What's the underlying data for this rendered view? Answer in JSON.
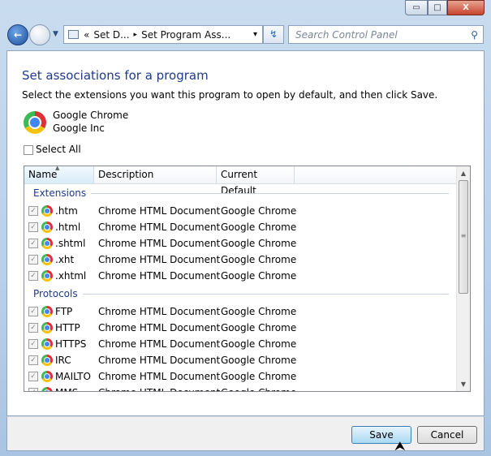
{
  "window": {
    "minimize": "▭",
    "maximize": "□",
    "close": "X"
  },
  "nav": {
    "breadcrumb_prefix": "«",
    "crumb1": "Set D...",
    "sep": "▸",
    "crumb2": "Set Program Ass...",
    "dropdown": "▾",
    "refresh": "↯",
    "search_placeholder": "Search Control Panel"
  },
  "page": {
    "title": "Set associations for a program",
    "instructions": "Select the extensions you want this program to open by default, and then click Save.",
    "program_name": "Google Chrome",
    "program_vendor": "Google Inc",
    "select_all": "Select All"
  },
  "list": {
    "columns": [
      "Name",
      "Description",
      "Current Default"
    ],
    "groups": [
      {
        "label": "Extensions",
        "items": [
          {
            "name": ".htm",
            "description": "Chrome HTML Document",
            "default": "Google Chrome",
            "checked": true
          },
          {
            "name": ".html",
            "description": "Chrome HTML Document",
            "default": "Google Chrome",
            "checked": true
          },
          {
            "name": ".shtml",
            "description": "Chrome HTML Document",
            "default": "Google Chrome",
            "checked": true
          },
          {
            "name": ".xht",
            "description": "Chrome HTML Document",
            "default": "Google Chrome",
            "checked": true
          },
          {
            "name": ".xhtml",
            "description": "Chrome HTML Document",
            "default": "Google Chrome",
            "checked": true
          }
        ]
      },
      {
        "label": "Protocols",
        "items": [
          {
            "name": "FTP",
            "description": "Chrome HTML Document",
            "default": "Google Chrome",
            "checked": true
          },
          {
            "name": "HTTP",
            "description": "Chrome HTML Document",
            "default": "Google Chrome",
            "checked": true
          },
          {
            "name": "HTTPS",
            "description": "Chrome HTML Document",
            "default": "Google Chrome",
            "checked": true
          },
          {
            "name": "IRC",
            "description": "Chrome HTML Document",
            "default": "Google Chrome",
            "checked": true
          },
          {
            "name": "MAILTO",
            "description": "Chrome HTML Document",
            "default": "Google Chrome",
            "checked": true
          },
          {
            "name": "MMS",
            "description": "Chrome HTML Document",
            "default": "Google Chrome",
            "checked": true
          }
        ]
      }
    ]
  },
  "footer": {
    "save": "Save",
    "cancel": "Cancel"
  }
}
